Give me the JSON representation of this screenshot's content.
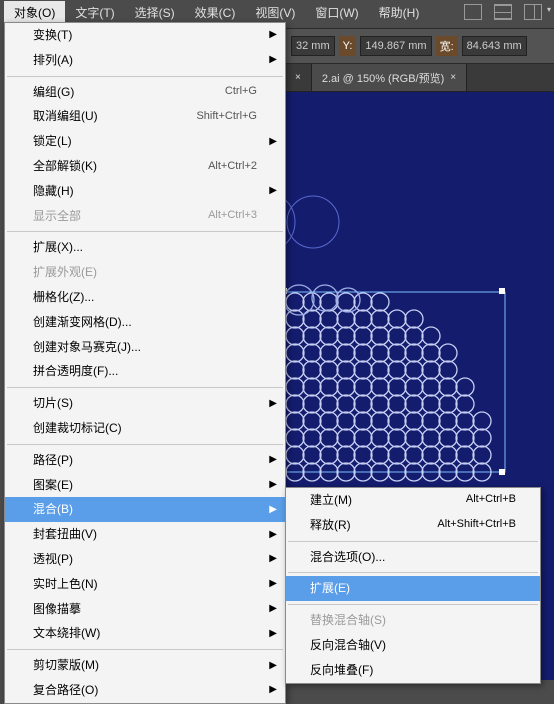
{
  "menubar": {
    "items": [
      {
        "label": "对象(O)",
        "active": true
      },
      {
        "label": "文字(T)"
      },
      {
        "label": "选择(S)"
      },
      {
        "label": "效果(C)"
      },
      {
        "label": "视图(V)"
      },
      {
        "label": "窗口(W)"
      },
      {
        "label": "帮助(H)"
      }
    ]
  },
  "toolbar": {
    "x_unit": "32 mm",
    "y_label": "Y:",
    "y_value": "149.867",
    "w_label": "宽:",
    "w_value": "84.643",
    "unit": "mm"
  },
  "tabs": {
    "active": {
      "label": "2.ai @ 150% (RGB/预览)"
    }
  },
  "object_menu": [
    {
      "type": "item",
      "label": "变换(T)",
      "submenu": true
    },
    {
      "type": "item",
      "label": "排列(A)",
      "submenu": true
    },
    {
      "type": "sep"
    },
    {
      "type": "item",
      "label": "编组(G)",
      "shortcut": "Ctrl+G"
    },
    {
      "type": "item",
      "label": "取消编组(U)",
      "shortcut": "Shift+Ctrl+G"
    },
    {
      "type": "item",
      "label": "锁定(L)",
      "submenu": true
    },
    {
      "type": "item",
      "label": "全部解锁(K)",
      "shortcut": "Alt+Ctrl+2"
    },
    {
      "type": "item",
      "label": "隐藏(H)",
      "submenu": true
    },
    {
      "type": "item",
      "label": "显示全部",
      "shortcut": "Alt+Ctrl+3",
      "disabled": true
    },
    {
      "type": "sep"
    },
    {
      "type": "item",
      "label": "扩展(X)..."
    },
    {
      "type": "item",
      "label": "扩展外观(E)",
      "disabled": true
    },
    {
      "type": "item",
      "label": "栅格化(Z)..."
    },
    {
      "type": "item",
      "label": "创建渐变网格(D)..."
    },
    {
      "type": "item",
      "label": "创建对象马赛克(J)..."
    },
    {
      "type": "item",
      "label": "拼合透明度(F)..."
    },
    {
      "type": "sep"
    },
    {
      "type": "item",
      "label": "切片(S)",
      "submenu": true
    },
    {
      "type": "item",
      "label": "创建裁切标记(C)"
    },
    {
      "type": "sep"
    },
    {
      "type": "item",
      "label": "路径(P)",
      "submenu": true
    },
    {
      "type": "item",
      "label": "图案(E)",
      "submenu": true
    },
    {
      "type": "item",
      "label": "混合(B)",
      "submenu": true,
      "hover": true
    },
    {
      "type": "item",
      "label": "封套扭曲(V)",
      "submenu": true
    },
    {
      "type": "item",
      "label": "透视(P)",
      "submenu": true
    },
    {
      "type": "item",
      "label": "实时上色(N)",
      "submenu": true
    },
    {
      "type": "item",
      "label": "图像描摹",
      "submenu": true
    },
    {
      "type": "item",
      "label": "文本绕排(W)",
      "submenu": true
    },
    {
      "type": "sep"
    },
    {
      "type": "item",
      "label": "剪切蒙版(M)",
      "submenu": true
    },
    {
      "type": "item",
      "label": "复合路径(O)",
      "submenu": true
    }
  ],
  "blend_submenu": [
    {
      "type": "item",
      "label": "建立(M)",
      "shortcut": "Alt+Ctrl+B"
    },
    {
      "type": "item",
      "label": "释放(R)",
      "shortcut": "Alt+Shift+Ctrl+B"
    },
    {
      "type": "sep"
    },
    {
      "type": "item",
      "label": "混合选项(O)..."
    },
    {
      "type": "sep"
    },
    {
      "type": "item",
      "label": "扩展(E)",
      "hover": true
    },
    {
      "type": "sep"
    },
    {
      "type": "item",
      "label": "替换混合轴(S)",
      "disabled": true
    },
    {
      "type": "item",
      "label": "反向混合轴(V)"
    },
    {
      "type": "item",
      "label": "反向堆叠(F)"
    }
  ]
}
